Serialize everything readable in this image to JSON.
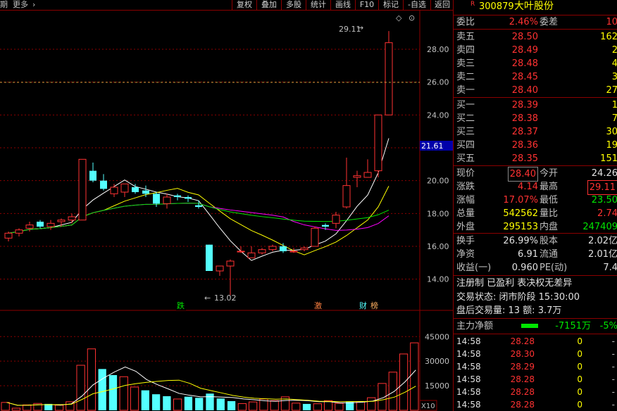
{
  "toolbar": {
    "left_items": [
      "期",
      "更多",
      "›"
    ],
    "buttons": [
      "复权",
      "叠加",
      "多股",
      "统计",
      "画线",
      "F10",
      "标记",
      "-自选",
      "返回"
    ]
  },
  "chart": {
    "price_ticks": [
      "28.00",
      "26.00",
      "24.00",
      "22.00",
      "20.00",
      "18.00",
      "16.00",
      "14.00"
    ],
    "volume_ticks": [
      "45000",
      "30000",
      "15000"
    ],
    "volume_unit": "X10",
    "current_price_label": "21.61",
    "high_annotation": "29.11",
    "low_annotation": "13.02",
    "markers": [
      "跌",
      "激",
      "财",
      "榜"
    ],
    "colors": {
      "up": "#ff3232",
      "down": "#54ffff",
      "ma5": "#ffffff",
      "ma10": "#ffff00",
      "ma20": "#ff00ff",
      "ma60": "#00e600",
      "grid": "#8b0000"
    }
  },
  "chart_data": {
    "type": "candlestick",
    "ylim": [
      13.0,
      29.5
    ],
    "candles": [
      {
        "o": 16.5,
        "h": 16.9,
        "l": 16.3,
        "c": 16.8
      },
      {
        "o": 16.8,
        "h": 17.1,
        "l": 16.6,
        "c": 17.0
      },
      {
        "o": 17.1,
        "h": 17.5,
        "l": 16.9,
        "c": 17.3
      },
      {
        "o": 17.5,
        "h": 17.6,
        "l": 17.1,
        "c": 17.2
      },
      {
        "o": 17.2,
        "h": 17.6,
        "l": 17.0,
        "c": 17.4
      },
      {
        "o": 17.5,
        "h": 17.7,
        "l": 17.2,
        "c": 17.6
      },
      {
        "o": 17.6,
        "h": 18.0,
        "l": 17.4,
        "c": 17.8
      },
      {
        "o": 17.6,
        "h": 21.3,
        "l": 17.6,
        "c": 21.3
      },
      {
        "o": 20.6,
        "h": 21.1,
        "l": 19.9,
        "c": 20.0
      },
      {
        "o": 20.0,
        "h": 20.4,
        "l": 19.4,
        "c": 19.5
      },
      {
        "o": 19.2,
        "h": 19.8,
        "l": 19.0,
        "c": 19.6
      },
      {
        "o": 19.3,
        "h": 19.8,
        "l": 19.0,
        "c": 19.8
      },
      {
        "o": 19.6,
        "h": 19.8,
        "l": 19.2,
        "c": 19.3
      },
      {
        "o": 19.4,
        "h": 19.7,
        "l": 19.0,
        "c": 19.2
      },
      {
        "o": 19.2,
        "h": 19.3,
        "l": 18.4,
        "c": 18.6
      },
      {
        "o": 18.6,
        "h": 19.2,
        "l": 18.3,
        "c": 19.0
      },
      {
        "o": 19.1,
        "h": 19.2,
        "l": 18.8,
        "c": 19.0
      },
      {
        "o": 19.0,
        "h": 19.1,
        "l": 18.7,
        "c": 18.9
      },
      {
        "o": 18.5,
        "h": 18.8,
        "l": 18.3,
        "c": 18.4
      },
      {
        "o": 16.1,
        "h": 16.1,
        "l": 14.5,
        "c": 14.5
      },
      {
        "o": 14.5,
        "h": 14.8,
        "l": 14.2,
        "c": 14.8
      },
      {
        "o": 14.8,
        "h": 15.2,
        "l": 13.02,
        "c": 15.1
      },
      {
        "o": 15.7,
        "h": 16.0,
        "l": 15.6,
        "c": 15.7
      },
      {
        "o": 15.3,
        "h": 16.0,
        "l": 15.3,
        "c": 15.6
      },
      {
        "o": 15.6,
        "h": 15.9,
        "l": 15.5,
        "c": 15.8
      },
      {
        "o": 15.8,
        "h": 16.1,
        "l": 15.7,
        "c": 16.0
      },
      {
        "o": 16.0,
        "h": 16.2,
        "l": 15.6,
        "c": 15.7
      },
      {
        "o": 15.7,
        "h": 15.9,
        "l": 15.6,
        "c": 15.7
      },
      {
        "o": 15.8,
        "h": 16.0,
        "l": 15.7,
        "c": 15.9
      },
      {
        "o": 16.0,
        "h": 17.2,
        "l": 16.0,
        "c": 17.1
      },
      {
        "o": 17.3,
        "h": 17.4,
        "l": 17.0,
        "c": 17.2
      },
      {
        "o": 17.4,
        "h": 18.1,
        "l": 17.1,
        "c": 17.9
      },
      {
        "o": 18.4,
        "h": 21.4,
        "l": 18.3,
        "c": 19.7
      },
      {
        "o": 20.2,
        "h": 20.6,
        "l": 19.6,
        "c": 20.3
      },
      {
        "o": 20.2,
        "h": 21.3,
        "l": 20.2,
        "c": 20.5
      },
      {
        "o": 20.6,
        "h": 22.4,
        "l": 20.2,
        "c": 24.0
      },
      {
        "o": 24.0,
        "h": 29.11,
        "l": 24.0,
        "c": 28.4
      }
    ],
    "volumes": [
      4800,
      1300,
      3300,
      4200,
      3900,
      3100,
      5200,
      27500,
      37500,
      25200,
      21500,
      20500,
      14200,
      12200,
      9800,
      8600,
      6900,
      8300,
      7600,
      10200,
      7200,
      5600,
      4100,
      5100,
      6900,
      5900,
      8200,
      4400,
      3900,
      4000,
      5900,
      4300,
      5100,
      5300,
      7700,
      16400,
      23300,
      34400,
      41200
    ]
  },
  "quote": {
    "code": "300879",
    "name": "大叶股份",
    "r_badge": "R",
    "weibi_label": "委比",
    "weibi_value": "2.46%",
    "weicha_label": "委差",
    "weicha_value": "10",
    "asks": [
      {
        "label": "卖五",
        "price": "28.50",
        "vol": "162"
      },
      {
        "label": "卖四",
        "price": "28.49",
        "vol": "2"
      },
      {
        "label": "卖三",
        "price": "28.48",
        "vol": "4"
      },
      {
        "label": "卖二",
        "price": "28.45",
        "vol": "3"
      },
      {
        "label": "卖一",
        "price": "28.40",
        "vol": "27"
      }
    ],
    "bids": [
      {
        "label": "买一",
        "price": "28.39",
        "vol": "1"
      },
      {
        "label": "买二",
        "price": "28.38",
        "vol": "7"
      },
      {
        "label": "买三",
        "price": "28.37",
        "vol": "30"
      },
      {
        "label": "买四",
        "price": "28.36",
        "vol": "19"
      },
      {
        "label": "买五",
        "price": "28.35",
        "vol": "151"
      }
    ],
    "stats": [
      {
        "l1": "现价",
        "v1": "28.40",
        "l2": "今开",
        "v2": "24.26"
      },
      {
        "l1": "涨跌",
        "v1": "4.14",
        "l2": "最高",
        "v2": "29.11"
      },
      {
        "l1": "涨幅",
        "v1": "17.07%",
        "l2": "最低",
        "v2": "23.50"
      },
      {
        "l1": "总量",
        "v1": "542562",
        "l2": "量比",
        "v2": "2.74"
      },
      {
        "l1": "外盘",
        "v1": "295153",
        "l2": "内盘",
        "v2": "247409"
      }
    ],
    "stats2": [
      {
        "l1": "换手",
        "v1": "26.99%",
        "l2": "股本",
        "v2": "2.02亿"
      },
      {
        "l1": "净资",
        "v1": "6.91",
        "l2": "流通",
        "v2": "2.01亿"
      },
      {
        "l1": "收益(一)",
        "v1": "0.960",
        "l2": "PE(动)",
        "v2": "7.4"
      }
    ],
    "info_line": "注册制 已盈利 表决权无差异",
    "trade_status": "交易状态: 闭市阶段 15:30:00",
    "after_hours": "盘后交易量: 13  额: 3.7万",
    "main_flow_label": "主力净额",
    "main_flow_value": "-7151万",
    "main_flow_pct": "-5%",
    "ticks": [
      {
        "time": "14:58",
        "price": "28.28",
        "vol": "0"
      },
      {
        "time": "14:58",
        "price": "28.30",
        "vol": "0"
      },
      {
        "time": "14:58",
        "price": "28.29",
        "vol": "0"
      },
      {
        "time": "14:58",
        "price": "28.28",
        "vol": "0"
      },
      {
        "time": "14:58",
        "price": "28.28",
        "vol": "0"
      },
      {
        "time": "14:58",
        "price": "28.28",
        "vol": "0"
      }
    ]
  }
}
